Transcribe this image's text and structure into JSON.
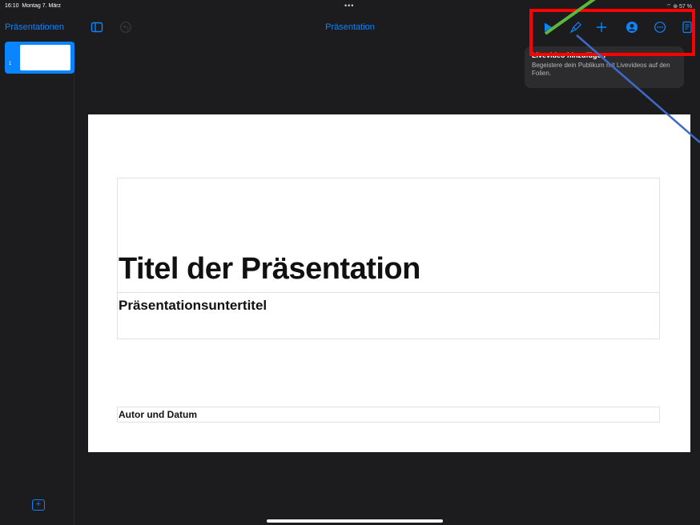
{
  "status": {
    "time": "16:10",
    "date": "Montag 7. März",
    "dots": "•••",
    "indicators": "⌔ ⊛ 57 %"
  },
  "toolbar": {
    "back_label": "Präsentationen",
    "title": "Präsentation",
    "icons": [
      "sidebar-icon",
      "undo-icon",
      "play-icon",
      "paintbrush-icon",
      "plus-icon",
      "collaborate-icon",
      "more-icon",
      "document-icon"
    ]
  },
  "sidebar": {
    "slides": [
      {
        "number": "1"
      }
    ],
    "add_slide": "+"
  },
  "slide": {
    "title": "Titel der Präsentation",
    "subtitle": "Präsentationsuntertitel",
    "author": "Autor und Datum"
  },
  "tooltip": {
    "title": "Livevideo hinzufügen",
    "description": "Begeistere dein Publikum mit Livevideos auf den Folien."
  },
  "colors": {
    "accent": "#0a84ff",
    "background": "#1c1c1e",
    "highlight": "#ff0000",
    "arrow_green": "#5cb83a",
    "arrow_blue": "#3d6bc7"
  }
}
